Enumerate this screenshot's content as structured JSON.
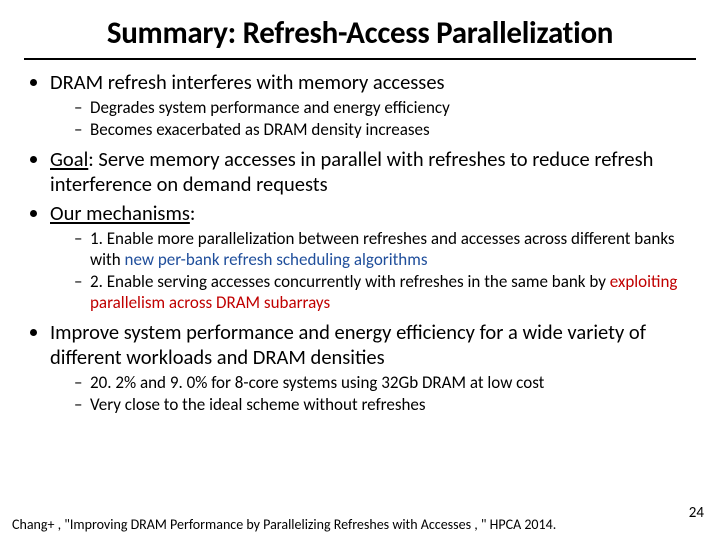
{
  "title": "Summary: Refresh-Access Parallelization",
  "b1": {
    "text": "DRAM refresh interferes with memory accesses",
    "sub1": "Degrades system performance and energy efficiency",
    "sub2": "Becomes exacerbated as DRAM density increases"
  },
  "b2": {
    "label": "Goal",
    "rest": ": Serve memory accesses in parallel with refreshes to reduce refresh interference on demand requests"
  },
  "b3": {
    "label": "Our mechanisms",
    "colon": ":",
    "sub1a": "1. Enable more parallelization between refreshes and accesses across different banks with ",
    "sub1b": "new per-bank refresh scheduling algorithms",
    "sub2a": "2. Enable serving accesses concurrently with refreshes in the same bank by ",
    "sub2b": "exploiting parallelism across DRAM subarrays"
  },
  "b4": {
    "text": "Improve system performance and energy efficiency for a wide variety of different workloads and DRAM densities",
    "sub1": "20. 2% and 9. 0% for 8-core systems using 32Gb DRAM at low cost",
    "sub2": "Very close to the ideal scheme without refreshes"
  },
  "footer": "Chang+ , \"Improving DRAM Performance by Parallelizing Refreshes with Accesses , \" HPCA 2014.",
  "page": "24"
}
